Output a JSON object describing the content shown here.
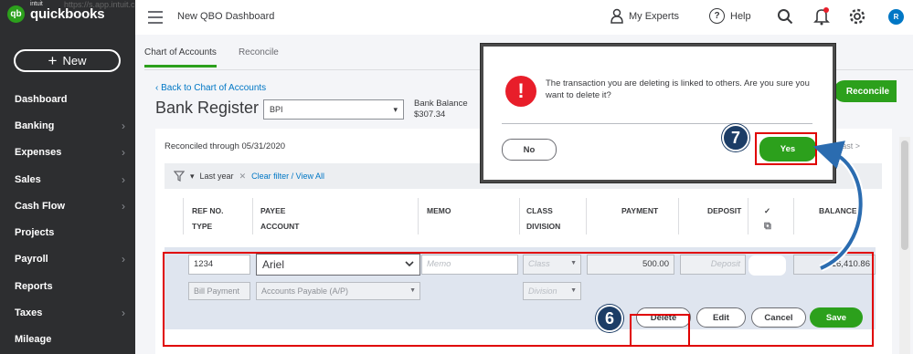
{
  "browser": {
    "url_fragment": "https://s.app.intuit.com"
  },
  "brand": {
    "badge": "qb",
    "intuit": "intuit",
    "name": "quickbooks"
  },
  "sidebar": {
    "new_label": "New",
    "items": [
      {
        "label": "Dashboard",
        "chevron": ""
      },
      {
        "label": "Banking",
        "chevron": "›"
      },
      {
        "label": "Expenses",
        "chevron": "›"
      },
      {
        "label": "Sales",
        "chevron": "›"
      },
      {
        "label": "Cash Flow",
        "chevron": "›"
      },
      {
        "label": "Projects",
        "chevron": ""
      },
      {
        "label": "Payroll",
        "chevron": "›"
      },
      {
        "label": "Reports",
        "chevron": ""
      },
      {
        "label": "Taxes",
        "chevron": "›"
      },
      {
        "label": "Mileage",
        "chevron": ""
      }
    ]
  },
  "header": {
    "title": "New QBO Dashboard",
    "experts": "My Experts",
    "help": "Help",
    "help_glyph": "?",
    "avatar": "R"
  },
  "tabs": [
    {
      "label": "Chart of Accounts"
    },
    {
      "label": "Reconcile"
    }
  ],
  "register": {
    "back": "‹  Back to Chart of Accounts",
    "title": "Bank Register",
    "account": "BPI",
    "balance_label": "Bank Balance",
    "balance_value": "$307.34",
    "reconcile_btn": "Reconcile",
    "reconciled_through": "Reconciled through 05/31/2020",
    "nav": "Last >",
    "filter_range": "Last year",
    "filter_clear": "Clear filter / View All",
    "columns": {
      "ref": "REF NO.",
      "type": "TYPE",
      "payee": "PAYEE",
      "account": "ACCOUNT",
      "memo": "MEMO",
      "class": "CLASS",
      "division": "DIVISION",
      "payment": "PAYMENT",
      "deposit": "DEPOSIT",
      "check": "✓",
      "balance": "BALANCE"
    }
  },
  "edit_row": {
    "ref": "1234",
    "payee": "Ariel",
    "memo_placeholder": "Memo",
    "class_placeholder": "Class",
    "payment": "500.00",
    "deposit_placeholder": "Deposit",
    "balance": "16,410.86",
    "type": "Bill Payment",
    "account": "Accounts Payable (A/P)",
    "division_placeholder": "Division",
    "buttons": {
      "delete": "Delete",
      "edit": "Edit",
      "cancel": "Cancel",
      "save": "Save"
    }
  },
  "modal": {
    "icon": "!",
    "message": "The transaction you are deleting is linked to others. Are you sure you want to delete it?",
    "no": "No",
    "yes": "Yes"
  },
  "annotations": {
    "step6": "6",
    "step7": "7"
  },
  "colors": {
    "sidebar_bg": "#2d2e30",
    "brand_green": "#2ca01c",
    "link_blue": "#0077c5",
    "alert_red": "#e81e2a",
    "highlight_red": "#e00000",
    "step_badge": "#1c3d66"
  }
}
